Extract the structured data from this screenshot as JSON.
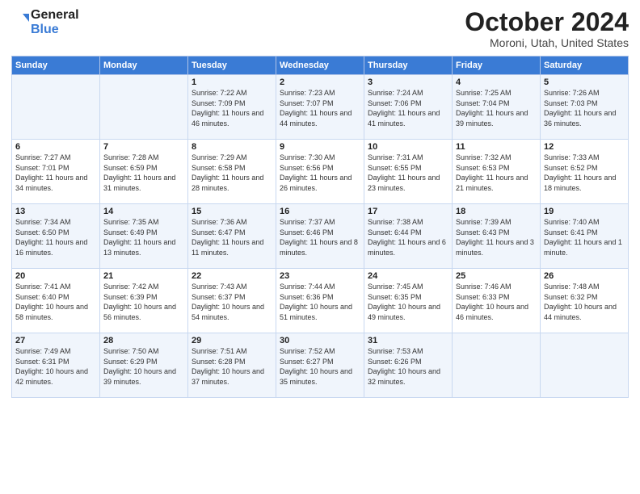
{
  "logo": {
    "line1": "General",
    "line2": "Blue"
  },
  "header": {
    "month": "October 2024",
    "location": "Moroni, Utah, United States"
  },
  "days_of_week": [
    "Sunday",
    "Monday",
    "Tuesday",
    "Wednesday",
    "Thursday",
    "Friday",
    "Saturday"
  ],
  "weeks": [
    [
      {
        "day": "",
        "sunrise": "",
        "sunset": "",
        "daylight": ""
      },
      {
        "day": "",
        "sunrise": "",
        "sunset": "",
        "daylight": ""
      },
      {
        "day": "1",
        "sunrise": "Sunrise: 7:22 AM",
        "sunset": "Sunset: 7:09 PM",
        "daylight": "Daylight: 11 hours and 46 minutes."
      },
      {
        "day": "2",
        "sunrise": "Sunrise: 7:23 AM",
        "sunset": "Sunset: 7:07 PM",
        "daylight": "Daylight: 11 hours and 44 minutes."
      },
      {
        "day": "3",
        "sunrise": "Sunrise: 7:24 AM",
        "sunset": "Sunset: 7:06 PM",
        "daylight": "Daylight: 11 hours and 41 minutes."
      },
      {
        "day": "4",
        "sunrise": "Sunrise: 7:25 AM",
        "sunset": "Sunset: 7:04 PM",
        "daylight": "Daylight: 11 hours and 39 minutes."
      },
      {
        "day": "5",
        "sunrise": "Sunrise: 7:26 AM",
        "sunset": "Sunset: 7:03 PM",
        "daylight": "Daylight: 11 hours and 36 minutes."
      }
    ],
    [
      {
        "day": "6",
        "sunrise": "Sunrise: 7:27 AM",
        "sunset": "Sunset: 7:01 PM",
        "daylight": "Daylight: 11 hours and 34 minutes."
      },
      {
        "day": "7",
        "sunrise": "Sunrise: 7:28 AM",
        "sunset": "Sunset: 6:59 PM",
        "daylight": "Daylight: 11 hours and 31 minutes."
      },
      {
        "day": "8",
        "sunrise": "Sunrise: 7:29 AM",
        "sunset": "Sunset: 6:58 PM",
        "daylight": "Daylight: 11 hours and 28 minutes."
      },
      {
        "day": "9",
        "sunrise": "Sunrise: 7:30 AM",
        "sunset": "Sunset: 6:56 PM",
        "daylight": "Daylight: 11 hours and 26 minutes."
      },
      {
        "day": "10",
        "sunrise": "Sunrise: 7:31 AM",
        "sunset": "Sunset: 6:55 PM",
        "daylight": "Daylight: 11 hours and 23 minutes."
      },
      {
        "day": "11",
        "sunrise": "Sunrise: 7:32 AM",
        "sunset": "Sunset: 6:53 PM",
        "daylight": "Daylight: 11 hours and 21 minutes."
      },
      {
        "day": "12",
        "sunrise": "Sunrise: 7:33 AM",
        "sunset": "Sunset: 6:52 PM",
        "daylight": "Daylight: 11 hours and 18 minutes."
      }
    ],
    [
      {
        "day": "13",
        "sunrise": "Sunrise: 7:34 AM",
        "sunset": "Sunset: 6:50 PM",
        "daylight": "Daylight: 11 hours and 16 minutes."
      },
      {
        "day": "14",
        "sunrise": "Sunrise: 7:35 AM",
        "sunset": "Sunset: 6:49 PM",
        "daylight": "Daylight: 11 hours and 13 minutes."
      },
      {
        "day": "15",
        "sunrise": "Sunrise: 7:36 AM",
        "sunset": "Sunset: 6:47 PM",
        "daylight": "Daylight: 11 hours and 11 minutes."
      },
      {
        "day": "16",
        "sunrise": "Sunrise: 7:37 AM",
        "sunset": "Sunset: 6:46 PM",
        "daylight": "Daylight: 11 hours and 8 minutes."
      },
      {
        "day": "17",
        "sunrise": "Sunrise: 7:38 AM",
        "sunset": "Sunset: 6:44 PM",
        "daylight": "Daylight: 11 hours and 6 minutes."
      },
      {
        "day": "18",
        "sunrise": "Sunrise: 7:39 AM",
        "sunset": "Sunset: 6:43 PM",
        "daylight": "Daylight: 11 hours and 3 minutes."
      },
      {
        "day": "19",
        "sunrise": "Sunrise: 7:40 AM",
        "sunset": "Sunset: 6:41 PM",
        "daylight": "Daylight: 11 hours and 1 minute."
      }
    ],
    [
      {
        "day": "20",
        "sunrise": "Sunrise: 7:41 AM",
        "sunset": "Sunset: 6:40 PM",
        "daylight": "Daylight: 10 hours and 58 minutes."
      },
      {
        "day": "21",
        "sunrise": "Sunrise: 7:42 AM",
        "sunset": "Sunset: 6:39 PM",
        "daylight": "Daylight: 10 hours and 56 minutes."
      },
      {
        "day": "22",
        "sunrise": "Sunrise: 7:43 AM",
        "sunset": "Sunset: 6:37 PM",
        "daylight": "Daylight: 10 hours and 54 minutes."
      },
      {
        "day": "23",
        "sunrise": "Sunrise: 7:44 AM",
        "sunset": "Sunset: 6:36 PM",
        "daylight": "Daylight: 10 hours and 51 minutes."
      },
      {
        "day": "24",
        "sunrise": "Sunrise: 7:45 AM",
        "sunset": "Sunset: 6:35 PM",
        "daylight": "Daylight: 10 hours and 49 minutes."
      },
      {
        "day": "25",
        "sunrise": "Sunrise: 7:46 AM",
        "sunset": "Sunset: 6:33 PM",
        "daylight": "Daylight: 10 hours and 46 minutes."
      },
      {
        "day": "26",
        "sunrise": "Sunrise: 7:48 AM",
        "sunset": "Sunset: 6:32 PM",
        "daylight": "Daylight: 10 hours and 44 minutes."
      }
    ],
    [
      {
        "day": "27",
        "sunrise": "Sunrise: 7:49 AM",
        "sunset": "Sunset: 6:31 PM",
        "daylight": "Daylight: 10 hours and 42 minutes."
      },
      {
        "day": "28",
        "sunrise": "Sunrise: 7:50 AM",
        "sunset": "Sunset: 6:29 PM",
        "daylight": "Daylight: 10 hours and 39 minutes."
      },
      {
        "day": "29",
        "sunrise": "Sunrise: 7:51 AM",
        "sunset": "Sunset: 6:28 PM",
        "daylight": "Daylight: 10 hours and 37 minutes."
      },
      {
        "day": "30",
        "sunrise": "Sunrise: 7:52 AM",
        "sunset": "Sunset: 6:27 PM",
        "daylight": "Daylight: 10 hours and 35 minutes."
      },
      {
        "day": "31",
        "sunrise": "Sunrise: 7:53 AM",
        "sunset": "Sunset: 6:26 PM",
        "daylight": "Daylight: 10 hours and 32 minutes."
      },
      {
        "day": "",
        "sunrise": "",
        "sunset": "",
        "daylight": ""
      },
      {
        "day": "",
        "sunrise": "",
        "sunset": "",
        "daylight": ""
      }
    ]
  ]
}
